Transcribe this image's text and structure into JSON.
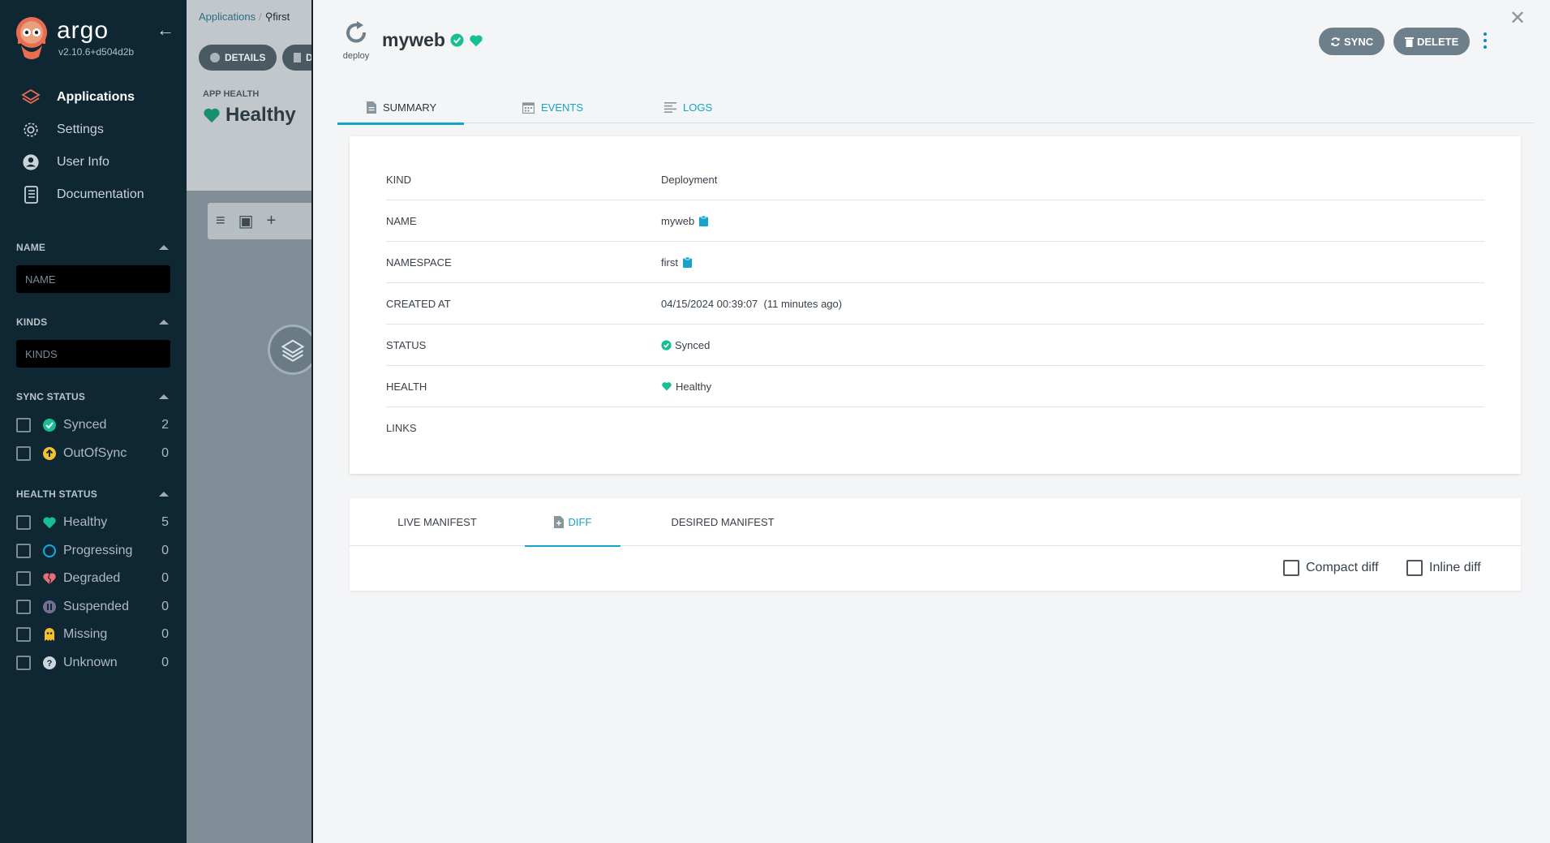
{
  "sidebar": {
    "brand": {
      "name": "argo",
      "version": "v2.10.6+d504d2b"
    },
    "nav": [
      {
        "label": "Applications",
        "icon": "layers-icon",
        "active": true
      },
      {
        "label": "Settings",
        "icon": "gear-icon",
        "active": false
      },
      {
        "label": "User Info",
        "icon": "user-icon",
        "active": false
      },
      {
        "label": "Documentation",
        "icon": "book-icon",
        "active": false
      }
    ],
    "filters": {
      "name": {
        "title": "NAME",
        "placeholder": "NAME"
      },
      "kinds": {
        "title": "KINDS",
        "placeholder": "KINDS"
      },
      "sync_status": {
        "title": "SYNC STATUS",
        "options": [
          {
            "label": "Synced",
            "count": "2",
            "icon": "check-circle-icon",
            "color": "#18be94"
          },
          {
            "label": "OutOfSync",
            "count": "0",
            "icon": "arrow-up-circle-icon",
            "color": "#f4c030"
          }
        ]
      },
      "health_status": {
        "title": "HEALTH STATUS",
        "options": [
          {
            "label": "Healthy",
            "count": "5",
            "icon": "heart-icon",
            "color": "#18be94"
          },
          {
            "label": "Progressing",
            "count": "0",
            "icon": "progress-circle-icon",
            "color": "#0dadea"
          },
          {
            "label": "Degraded",
            "count": "0",
            "icon": "broken-heart-icon",
            "color": "#e96d76"
          },
          {
            "label": "Suspended",
            "count": "0",
            "icon": "pause-circle-icon",
            "color": "#766f94"
          },
          {
            "label": "Missing",
            "count": "0",
            "icon": "ghost-icon",
            "color": "#f4c030"
          },
          {
            "label": "Unknown",
            "count": "0",
            "icon": "question-circle-icon",
            "color": "#ccd6dd"
          }
        ]
      }
    }
  },
  "background": {
    "breadcrumb": {
      "root": "Applications",
      "search": "first"
    },
    "details_button": "DETAILS",
    "second_button": "D",
    "app_health_label": "APP HEALTH",
    "app_health_value": "Healthy"
  },
  "panel": {
    "kind_label": "deploy",
    "resource_name": "myweb",
    "buttons": {
      "sync": "SYNC",
      "delete": "DELETE"
    },
    "tabs": [
      {
        "label": "SUMMARY",
        "icon": "document-icon",
        "active": true
      },
      {
        "label": "EVENTS",
        "icon": "calendar-icon",
        "active": false
      },
      {
        "label": "LOGS",
        "icon": "lines-icon",
        "active": false
      }
    ],
    "summary": {
      "kind": {
        "key": "KIND",
        "value": "Deployment"
      },
      "name": {
        "key": "NAME",
        "value": "myweb"
      },
      "namespace": {
        "key": "NAMESPACE",
        "value": "first"
      },
      "created_at": {
        "key": "CREATED AT",
        "value": "04/15/2024 00:39:07  (11 minutes ago)"
      },
      "status": {
        "key": "STATUS",
        "value": "Synced"
      },
      "health": {
        "key": "HEALTH",
        "value": "Healthy"
      },
      "links": {
        "key": "LINKS",
        "value": ""
      }
    },
    "manifest_tabs": [
      {
        "label": "LIVE MANIFEST",
        "active": false
      },
      {
        "label": "DIFF",
        "active": true
      },
      {
        "label": "DESIRED MANIFEST",
        "active": false
      }
    ],
    "options": {
      "compact_diff": "Compact diff",
      "inline_diff": "Inline diff"
    }
  },
  "colors": {
    "accent": "#17a2c9",
    "sidebar_bg": "#0f2733",
    "success": "#18be94"
  }
}
